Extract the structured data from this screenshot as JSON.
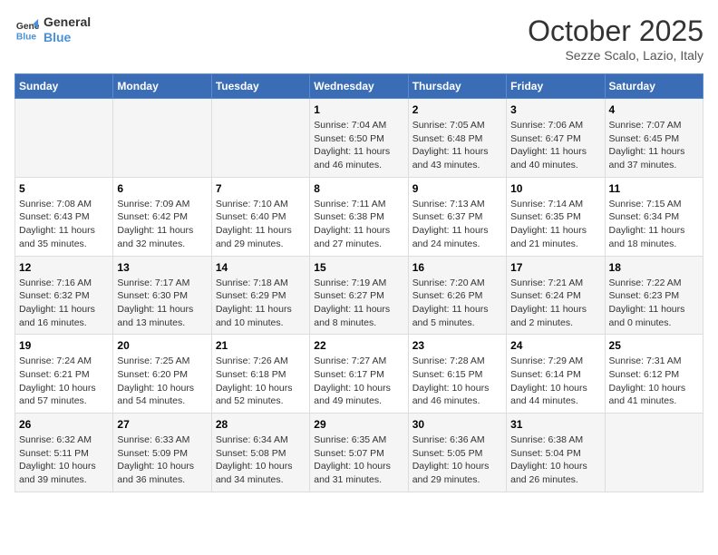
{
  "logo": {
    "line1": "General",
    "line2": "Blue"
  },
  "title": "October 2025",
  "subtitle": "Sezze Scalo, Lazio, Italy",
  "days_of_week": [
    "Sunday",
    "Monday",
    "Tuesday",
    "Wednesday",
    "Thursday",
    "Friday",
    "Saturday"
  ],
  "weeks": [
    [
      {
        "day": "",
        "info": ""
      },
      {
        "day": "",
        "info": ""
      },
      {
        "day": "",
        "info": ""
      },
      {
        "day": "1",
        "info": "Sunrise: 7:04 AM\nSunset: 6:50 PM\nDaylight: 11 hours and 46 minutes."
      },
      {
        "day": "2",
        "info": "Sunrise: 7:05 AM\nSunset: 6:48 PM\nDaylight: 11 hours and 43 minutes."
      },
      {
        "day": "3",
        "info": "Sunrise: 7:06 AM\nSunset: 6:47 PM\nDaylight: 11 hours and 40 minutes."
      },
      {
        "day": "4",
        "info": "Sunrise: 7:07 AM\nSunset: 6:45 PM\nDaylight: 11 hours and 37 minutes."
      }
    ],
    [
      {
        "day": "5",
        "info": "Sunrise: 7:08 AM\nSunset: 6:43 PM\nDaylight: 11 hours and 35 minutes."
      },
      {
        "day": "6",
        "info": "Sunrise: 7:09 AM\nSunset: 6:42 PM\nDaylight: 11 hours and 32 minutes."
      },
      {
        "day": "7",
        "info": "Sunrise: 7:10 AM\nSunset: 6:40 PM\nDaylight: 11 hours and 29 minutes."
      },
      {
        "day": "8",
        "info": "Sunrise: 7:11 AM\nSunset: 6:38 PM\nDaylight: 11 hours and 27 minutes."
      },
      {
        "day": "9",
        "info": "Sunrise: 7:13 AM\nSunset: 6:37 PM\nDaylight: 11 hours and 24 minutes."
      },
      {
        "day": "10",
        "info": "Sunrise: 7:14 AM\nSunset: 6:35 PM\nDaylight: 11 hours and 21 minutes."
      },
      {
        "day": "11",
        "info": "Sunrise: 7:15 AM\nSunset: 6:34 PM\nDaylight: 11 hours and 18 minutes."
      }
    ],
    [
      {
        "day": "12",
        "info": "Sunrise: 7:16 AM\nSunset: 6:32 PM\nDaylight: 11 hours and 16 minutes."
      },
      {
        "day": "13",
        "info": "Sunrise: 7:17 AM\nSunset: 6:30 PM\nDaylight: 11 hours and 13 minutes."
      },
      {
        "day": "14",
        "info": "Sunrise: 7:18 AM\nSunset: 6:29 PM\nDaylight: 11 hours and 10 minutes."
      },
      {
        "day": "15",
        "info": "Sunrise: 7:19 AM\nSunset: 6:27 PM\nDaylight: 11 hours and 8 minutes."
      },
      {
        "day": "16",
        "info": "Sunrise: 7:20 AM\nSunset: 6:26 PM\nDaylight: 11 hours and 5 minutes."
      },
      {
        "day": "17",
        "info": "Sunrise: 7:21 AM\nSunset: 6:24 PM\nDaylight: 11 hours and 2 minutes."
      },
      {
        "day": "18",
        "info": "Sunrise: 7:22 AM\nSunset: 6:23 PM\nDaylight: 11 hours and 0 minutes."
      }
    ],
    [
      {
        "day": "19",
        "info": "Sunrise: 7:24 AM\nSunset: 6:21 PM\nDaylight: 10 hours and 57 minutes."
      },
      {
        "day": "20",
        "info": "Sunrise: 7:25 AM\nSunset: 6:20 PM\nDaylight: 10 hours and 54 minutes."
      },
      {
        "day": "21",
        "info": "Sunrise: 7:26 AM\nSunset: 6:18 PM\nDaylight: 10 hours and 52 minutes."
      },
      {
        "day": "22",
        "info": "Sunrise: 7:27 AM\nSunset: 6:17 PM\nDaylight: 10 hours and 49 minutes."
      },
      {
        "day": "23",
        "info": "Sunrise: 7:28 AM\nSunset: 6:15 PM\nDaylight: 10 hours and 46 minutes."
      },
      {
        "day": "24",
        "info": "Sunrise: 7:29 AM\nSunset: 6:14 PM\nDaylight: 10 hours and 44 minutes."
      },
      {
        "day": "25",
        "info": "Sunrise: 7:31 AM\nSunset: 6:12 PM\nDaylight: 10 hours and 41 minutes."
      }
    ],
    [
      {
        "day": "26",
        "info": "Sunrise: 6:32 AM\nSunset: 5:11 PM\nDaylight: 10 hours and 39 minutes."
      },
      {
        "day": "27",
        "info": "Sunrise: 6:33 AM\nSunset: 5:09 PM\nDaylight: 10 hours and 36 minutes."
      },
      {
        "day": "28",
        "info": "Sunrise: 6:34 AM\nSunset: 5:08 PM\nDaylight: 10 hours and 34 minutes."
      },
      {
        "day": "29",
        "info": "Sunrise: 6:35 AM\nSunset: 5:07 PM\nDaylight: 10 hours and 31 minutes."
      },
      {
        "day": "30",
        "info": "Sunrise: 6:36 AM\nSunset: 5:05 PM\nDaylight: 10 hours and 29 minutes."
      },
      {
        "day": "31",
        "info": "Sunrise: 6:38 AM\nSunset: 5:04 PM\nDaylight: 10 hours and 26 minutes."
      },
      {
        "day": "",
        "info": ""
      }
    ]
  ]
}
